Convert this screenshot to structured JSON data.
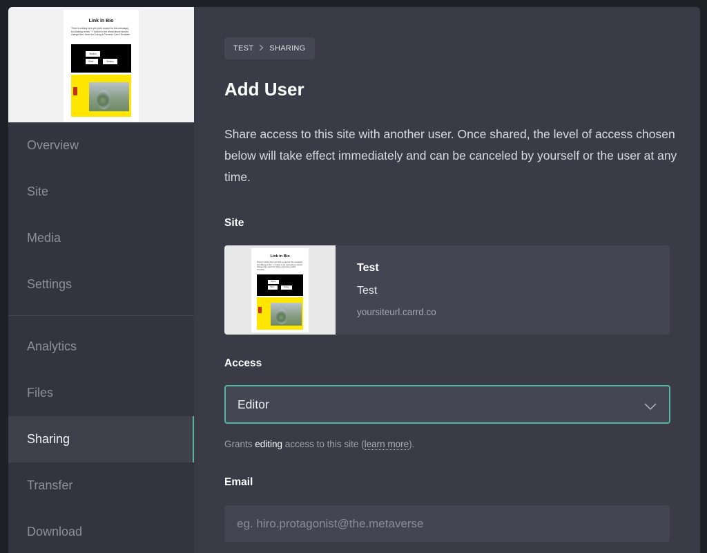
{
  "sidebar": {
    "thumbnail": {
      "title": "Link in Bio",
      "text": "There's nothing here yet (well, except for this message), but clicking on the \"+\" button in the menu above should change that. Have fun! Using a Premium Carrd Template",
      "button1": "Button",
      "button2": "Butt...",
      "button3": "Button"
    },
    "items": [
      {
        "label": "Overview"
      },
      {
        "label": "Site"
      },
      {
        "label": "Media"
      },
      {
        "label": "Settings"
      },
      {
        "label": "Analytics"
      },
      {
        "label": "Files"
      },
      {
        "label": "Sharing",
        "active": true
      },
      {
        "label": "Transfer"
      },
      {
        "label": "Download"
      }
    ]
  },
  "breadcrumb": {
    "parent": "TEST",
    "current": "SHARING"
  },
  "page": {
    "title": "Add User",
    "description": "Share access to this site with another user. Once shared, the level of access chosen below will take effect immediately and can be canceled by yourself or the user at any time."
  },
  "site_section": {
    "label": "Site",
    "name": "Test",
    "description": "Test",
    "url": "yoursiteurl.carrd.co"
  },
  "access_section": {
    "label": "Access",
    "selected": "Editor",
    "hint_prefix": "Grants ",
    "hint_highlight": "editing",
    "hint_middle": " access to this site (",
    "hint_link": "learn more",
    "hint_suffix": ")."
  },
  "email_section": {
    "label": "Email",
    "placeholder": "eg. hiro.protagonist@the.metaverse"
  },
  "colors": {
    "accent": "#4fb7a4",
    "background": "#3a3b47",
    "sidebar": "#33343f"
  }
}
